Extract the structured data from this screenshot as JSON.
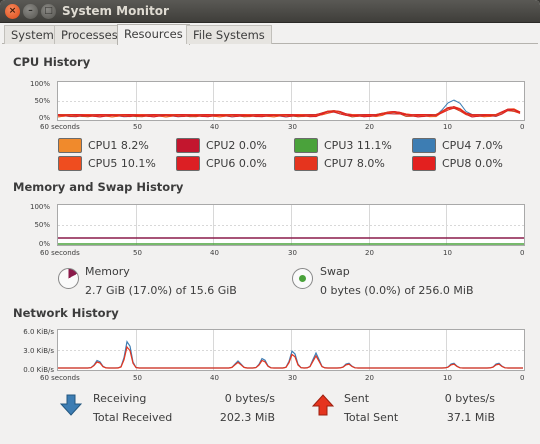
{
  "window": {
    "title": "System Monitor"
  },
  "tabs": [
    {
      "label": "System",
      "active": false
    },
    {
      "label": "Processes",
      "active": false
    },
    {
      "label": "Resources",
      "active": true
    },
    {
      "label": "File Systems",
      "active": false
    }
  ],
  "cpu": {
    "title": "CPU History",
    "y_ticks": [
      "100%",
      "50%",
      "0%"
    ],
    "x_ticks": [
      "60 seconds",
      "50",
      "40",
      "30",
      "20",
      "10",
      "0"
    ],
    "items": [
      {
        "label": "CPU1",
        "value": "8.2%",
        "color": "#f08a2c"
      },
      {
        "label": "CPU2",
        "value": "0.0%",
        "color": "#c3162e"
      },
      {
        "label": "CPU3",
        "value": "11.1%",
        "color": "#4aa23b"
      },
      {
        "label": "CPU4",
        "value": "7.0%",
        "color": "#3d7db3"
      },
      {
        "label": "CPU5",
        "value": "10.1%",
        "color": "#ef4d1f"
      },
      {
        "label": "CPU6",
        "value": "0.0%",
        "color": "#dc1f24"
      },
      {
        "label": "CPU7",
        "value": "8.0%",
        "color": "#e5341e"
      },
      {
        "label": "CPU8",
        "value": "0.0%",
        "color": "#e3201f"
      }
    ]
  },
  "memory": {
    "title": "Memory and Swap History",
    "y_ticks": [
      "100%",
      "50%",
      "0%"
    ],
    "x_ticks": [
      "60 seconds",
      "50",
      "40",
      "30",
      "20",
      "10",
      "0"
    ],
    "mem_label": "Memory",
    "mem_value": "2.7 GiB (17.0%) of 15.6 GiB",
    "mem_fraction": 0.17,
    "mem_color": "#8a1a4a",
    "swap_label": "Swap",
    "swap_value": "0 bytes (0.0%) of 256.0 MiB",
    "swap_fraction": 0.0,
    "swap_color": "#4aa23b"
  },
  "network": {
    "title": "Network History",
    "y_ticks": [
      "6.0 KiB/s",
      "3.0 KiB/s",
      "0.0 KiB/s"
    ],
    "x_ticks": [
      "60 seconds",
      "50",
      "40",
      "30",
      "20",
      "10",
      "0"
    ],
    "receiving_label": "Receiving",
    "receiving_value": "0 bytes/s",
    "total_received_label": "Total Received",
    "total_received_value": "202.3 MiB",
    "sent_label": "Sent",
    "sent_value": "0 bytes/s",
    "total_sent_label": "Total Sent",
    "total_sent_value": "37.1 MiB",
    "receive_color": "#3d7db3",
    "send_color": "#e5341e"
  }
}
